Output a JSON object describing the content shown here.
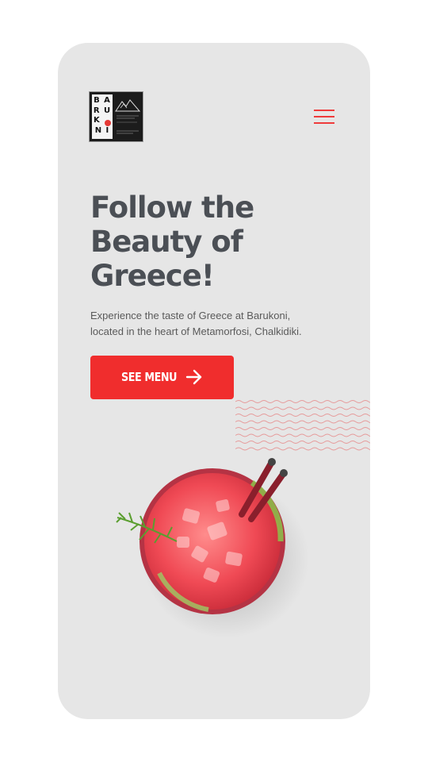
{
  "brand": {
    "name": "Barukoni",
    "logo_letters": [
      "B A",
      "R U",
      "K",
      "N I"
    ],
    "accent_color": "#f02d2d"
  },
  "header": {
    "menu_icon": "hamburger-menu-icon"
  },
  "hero": {
    "headline_lines": [
      "Follow the",
      "Beauty of",
      "Greece!"
    ],
    "description_lines": [
      "Experience the taste of Greece at Barukoni,",
      "located in the heart of Metamorfosi, Chalkidiki."
    ],
    "cta_label": "SEE MENU",
    "cta_icon": "arrow-right-icon"
  },
  "decor": {
    "wave_icon": "wave-pattern",
    "image": "red-cocktail-with-rosemary"
  }
}
